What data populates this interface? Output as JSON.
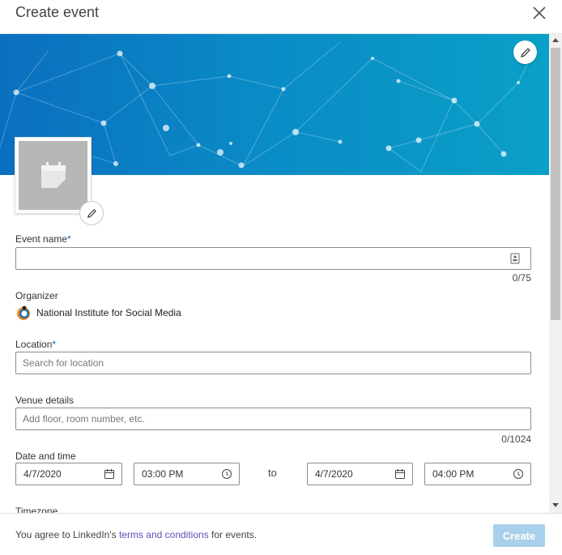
{
  "modal": {
    "title": "Create event"
  },
  "event_name": {
    "label": "Event name",
    "required_mark": "*",
    "value": "",
    "counter": "0/75"
  },
  "organizer": {
    "label": "Organizer",
    "name": "National Institute for Social Media"
  },
  "location": {
    "label": "Location",
    "required_mark": "*",
    "placeholder": "Search for location"
  },
  "venue": {
    "label": "Venue details",
    "placeholder": "Add floor, room number, etc.",
    "counter": "0/1024"
  },
  "datetime": {
    "label": "Date and time",
    "start_date": "4/7/2020",
    "start_time": "03:00 PM",
    "to": "to",
    "end_date": "4/7/2020",
    "end_time": "04:00 PM"
  },
  "timezone": {
    "label": "Timezone"
  },
  "footer": {
    "text_before": "You agree to LinkedIn's ",
    "link": "terms and conditions",
    "text_after": " for events.",
    "create_label": "Create"
  },
  "icons": {
    "close": "close-icon",
    "edit": "pencil-icon",
    "calendar": "calendar-icon",
    "clock": "clock-icon",
    "field_badge": "contact-card-icon"
  },
  "colors": {
    "accent": "#0a66c2",
    "banner_start": "#0b6fbf",
    "banner_end": "#0aa0c7",
    "create_disabled": "#a9d0ea",
    "link": "#5b4fbd"
  }
}
